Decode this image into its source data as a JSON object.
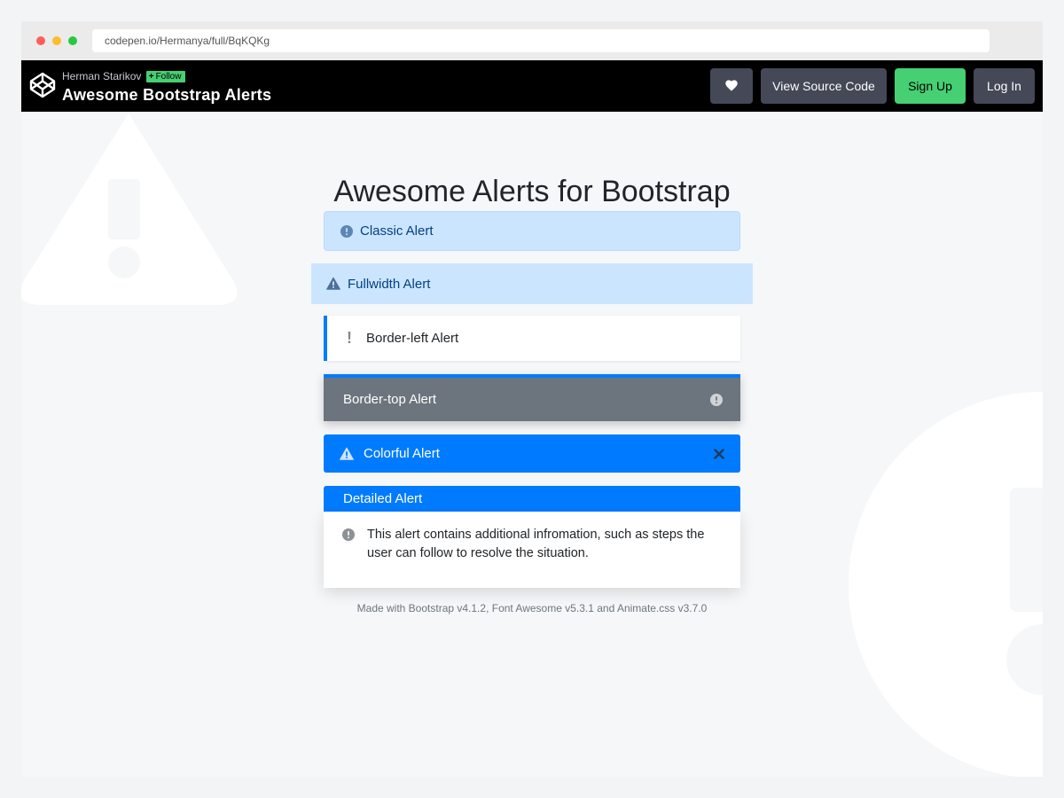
{
  "browser": {
    "url": "codepen.io/Hermanya/full/BqKQKg"
  },
  "header": {
    "author": "Herman Starikov",
    "follow_label": "Follow",
    "title": "Awesome Bootstrap Alerts",
    "buttons": {
      "source": "View Source Code",
      "signup": "Sign Up",
      "login": "Log In"
    }
  },
  "main": {
    "title": "Awesome Alerts for Bootstrap",
    "alerts": {
      "classic": "Classic Alert",
      "fullwidth": "Fullwidth Alert",
      "border_left": "Border-left Alert",
      "border_top": "Border-top Alert",
      "colorful": "Colorful Alert",
      "detailed_title": "Detailed Alert",
      "detailed_text": "This alert contains additional infromation, such as steps the user can follow to resolve the situation."
    },
    "footer": "Made with Bootstrap v4.1.2, Font Awesome v5.3.1 and Animate.css v3.7.0"
  },
  "icons": {
    "logo": "codepen-logo-icon",
    "heart": "heart-icon",
    "info": "info-circle-icon",
    "warning": "warning-triangle-icon",
    "exclamation": "exclamation-icon",
    "close": "close-icon"
  },
  "colors": {
    "primary": "#007bff",
    "info_bg": "#cce5ff",
    "info_text": "#004085",
    "secondary": "#6c757d",
    "codepen_green": "#47cf73"
  }
}
